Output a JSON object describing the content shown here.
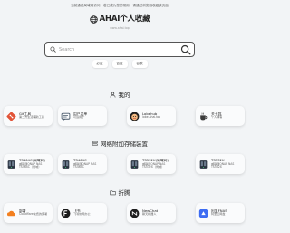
{
  "notice": "当前通过局域网访问，若已成为您的常用，请通过浏览器收藏该页面",
  "brand": {
    "title": "AHAI个人收藏",
    "subtitle": "www.ahai.top"
  },
  "search": {
    "placeholder": "Search",
    "value": ""
  },
  "engines": [
    "必应",
    "百度",
    "谷歌"
  ],
  "sections": [
    {
      "title": "我的",
      "icon": "user-icon",
      "cards": [
        {
          "title": "Git工具",
          "desc": "第二方生活辅助工具",
          "icon": "git-icon",
          "color": "#e25438"
        },
        {
          "title": "用户名单",
          "desc": "可运用于",
          "icon": "message-icon",
          "color": "#4a5a6b"
        },
        {
          "title": "Lobehub",
          "desc": "lobe.ahai.top",
          "icon": "lobe-icon",
          "color": "#1f1f1f"
        },
        {
          "title": "关于我",
          "desc": "个人博客",
          "icon": "coffee-icon",
          "color": "#3b3b3b"
        }
      ]
    },
    {
      "title": "网络附加存储装置",
      "icon": "server-icon",
      "cards": [
        {
          "title": "TS464C(局域网)",
          "desc": "威联通QNAP NAS TS464C（局域）",
          "icon": "nas-icon",
          "color": "#2a3340"
        },
        {
          "title": "TS464C",
          "desc": "威联通QNAP NAS TS464C",
          "icon": "nas-icon",
          "color": "#2a3340"
        },
        {
          "title": "TS532X(局域网)",
          "desc": "威联通QNAP NAS TS532X（局域）",
          "icon": "nas-icon",
          "color": "#2a3340"
        },
        {
          "title": "TS532X",
          "desc": "威联通QNAP NAS TS532X",
          "icon": "nas-icon",
          "color": "#2a3340"
        }
      ]
    },
    {
      "title": "折腾",
      "icon": "folder-icon",
      "cards": [
        {
          "title": "部署",
          "desc": "Cloudflare免费的部署",
          "icon": "cloud-icon",
          "color": "#f38020"
        },
        {
          "title": "飞书",
          "desc": "飞书协同办公",
          "icon": "feishu-icon",
          "color": "#1a1a1a"
        },
        {
          "title": "NewChat",
          "desc": "聊天机器人",
          "icon": "chat-icon",
          "color": "#1f1f1f"
        },
        {
          "title": "阿里FNAS",
          "desc": "阿里云网盘",
          "icon": "alidrive-icon",
          "color": "#3d6cf2"
        }
      ]
    }
  ]
}
